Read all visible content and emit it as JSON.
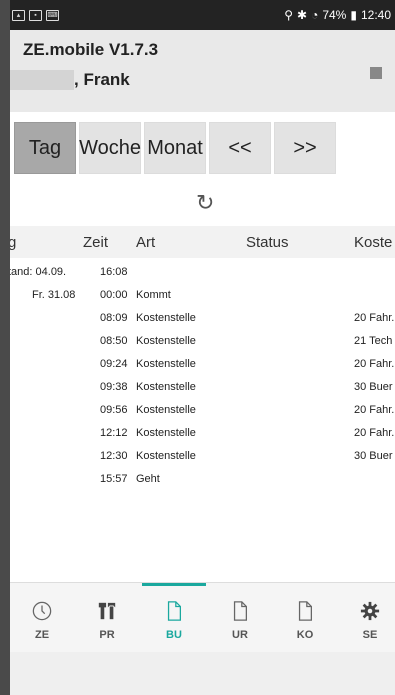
{
  "status_bar": {
    "left_icons": [
      "signal-icon",
      "image-icon",
      "keyboard-icon"
    ],
    "battery": "74%",
    "time": "12:40"
  },
  "header": {
    "title": "ZE.mobile V1.7.3",
    "user": ", Frank"
  },
  "buttons": {
    "tag": "Tag",
    "woche": "Woche",
    "monat": "Monat",
    "prev": "<<",
    "next": ">>"
  },
  "table": {
    "columns": [
      "g",
      "Zeit",
      "Art",
      "Status",
      "Koste"
    ],
    "rows": [
      {
        "day": "tand: 04.09.",
        "time": "16:08",
        "art": "",
        "status": "",
        "koste": ""
      },
      {
        "day": "Fr. 31.08",
        "time": "00:00",
        "art": "Kommt",
        "status": "",
        "koste": ""
      },
      {
        "day": "",
        "time": "08:09",
        "art": "Kostenstelle",
        "status": "",
        "koste": "20 Fahr."
      },
      {
        "day": "",
        "time": "08:50",
        "art": "Kostenstelle",
        "status": "",
        "koste": "21 Tech"
      },
      {
        "day": "",
        "time": "09:24",
        "art": "Kostenstelle",
        "status": "",
        "koste": "20 Fahr."
      },
      {
        "day": "",
        "time": "09:38",
        "art": "Kostenstelle",
        "status": "",
        "koste": "30 Buer"
      },
      {
        "day": "",
        "time": "09:56",
        "art": "Kostenstelle",
        "status": "",
        "koste": "20 Fahr."
      },
      {
        "day": "",
        "time": "12:12",
        "art": "Kostenstelle",
        "status": "",
        "koste": "20 Fahr."
      },
      {
        "day": "",
        "time": "12:30",
        "art": "Kostenstelle",
        "status": "",
        "koste": "30 Buer"
      },
      {
        "day": "",
        "time": "15:57",
        "art": "Geht",
        "status": "",
        "koste": ""
      }
    ]
  },
  "bottom_nav": {
    "ze": "ZE",
    "pr": "PR",
    "bu": "BU",
    "ur": "UR",
    "ko": "KO",
    "se": "SE",
    "active": "BU",
    "active_color": "#1aa89e"
  }
}
